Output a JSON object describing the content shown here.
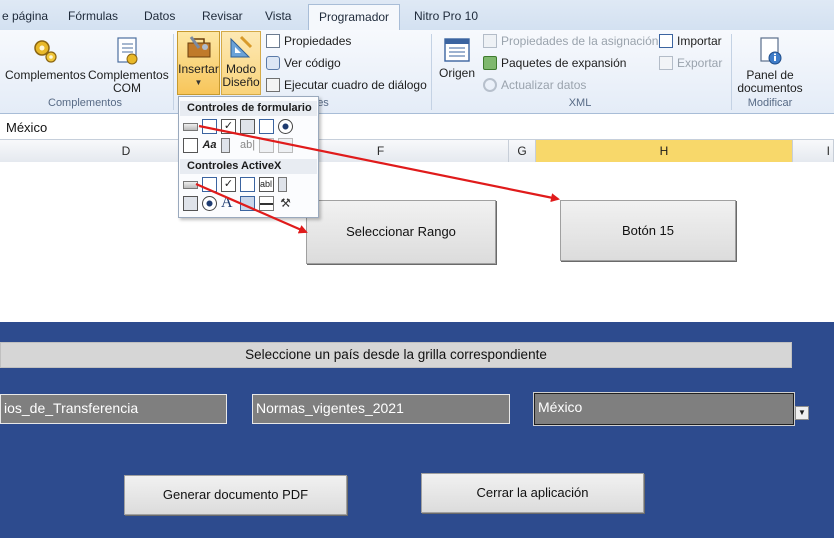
{
  "tabs": [
    {
      "label": "e página",
      "active": false
    },
    {
      "label": "Fórmulas",
      "active": false
    },
    {
      "label": "Datos",
      "active": false
    },
    {
      "label": "Revisar",
      "active": false
    },
    {
      "label": "Vista",
      "active": false
    },
    {
      "label": "Programador",
      "active": true
    },
    {
      "label": "Nitro Pro 10",
      "active": false
    }
  ],
  "ribbon": {
    "complementos_group": {
      "label": "Complementos",
      "complementos": "Complementos",
      "complementos_com": "Complementos COM"
    },
    "controles_group": {
      "label": "es",
      "insertar": "Insertar",
      "modo_diseno": "Modo Diseño",
      "propiedades": "Propiedades",
      "ver_codigo": "Ver código",
      "ejecutar": "Ejecutar cuadro de diálogo"
    },
    "xml_group": {
      "label": "XML",
      "origen": "Origen",
      "prop_asignacion": "Propiedades de la asignación",
      "paquetes": "Paquetes de expansión",
      "actualizar": "Actualizar datos",
      "importar": "Importar",
      "exportar": "Exportar"
    },
    "modificar_group": {
      "label": "Modificar",
      "panel": "Panel de documentos"
    }
  },
  "formula_bar": {
    "value": "México"
  },
  "columns": [
    "D",
    "F",
    "G",
    "H",
    "I"
  ],
  "dropdown": {
    "form_controls_title": "Controles de formulario",
    "activex_title": "Controles ActiveX"
  },
  "sheet": {
    "btn_seleccionar": "Seleccionar Rango",
    "btn_boton15": "Botón 15",
    "instruction": "Seleccione un país desde la grilla correspondiente",
    "field1": "ios_de_Transferencia",
    "field2": "Normas_vigentes_2021",
    "field3": "México",
    "btn_pdf": "Generar documento PDF",
    "btn_cerrar": "Cerrar la aplicación"
  },
  "colors": {
    "sheet_blue": "#2d4b8e",
    "arrow_red": "#e01b1b",
    "selected_column": "#f8d86a"
  }
}
